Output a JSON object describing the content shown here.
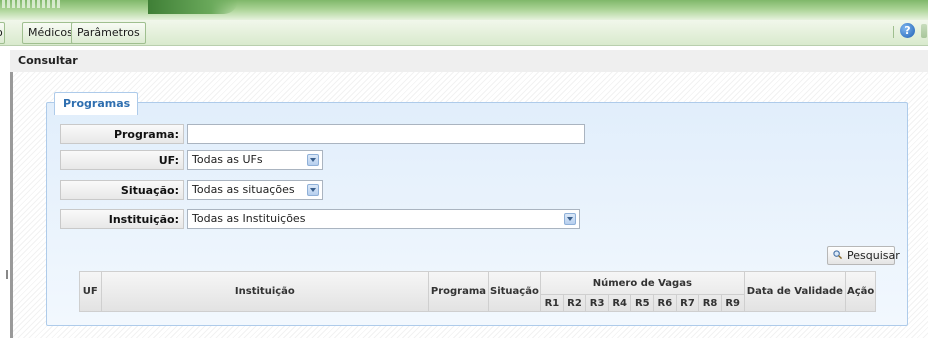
{
  "menu": {
    "partial_item": "o",
    "items": [
      "Médicos",
      "Parâmetros"
    ]
  },
  "breadcrumb": "Consultar",
  "panel": {
    "legend": "Programas"
  },
  "form": {
    "programa_label": "Programa:",
    "programa_value": "",
    "uf_label": "UF:",
    "uf_value": "Todas as UFs",
    "situacao_label": "Situação:",
    "situacao_value": "Todas as situações",
    "instituicao_label": "Instituição:",
    "instituicao_value": "Todas as Instituições"
  },
  "search_button": "Pesquisar",
  "table": {
    "headers": {
      "uf": "UF",
      "instituicao": "Instituição",
      "programa": "Programa",
      "situacao": "Situação",
      "numero_vagas": "Número de Vagas",
      "data_validade": "Data de Validade",
      "acao": "Ação"
    },
    "vagas_columns": [
      "R1",
      "R2",
      "R3",
      "R4",
      "R5",
      "R6",
      "R7",
      "R8",
      "R9"
    ]
  },
  "icons": {
    "help": "help-icon",
    "search": "search-icon",
    "dropdown": "chevron-down-icon"
  },
  "colors": {
    "menu_green": "#d9eacd",
    "panel_blue": "#e1eefb",
    "legend_text": "#2f6fb0"
  }
}
